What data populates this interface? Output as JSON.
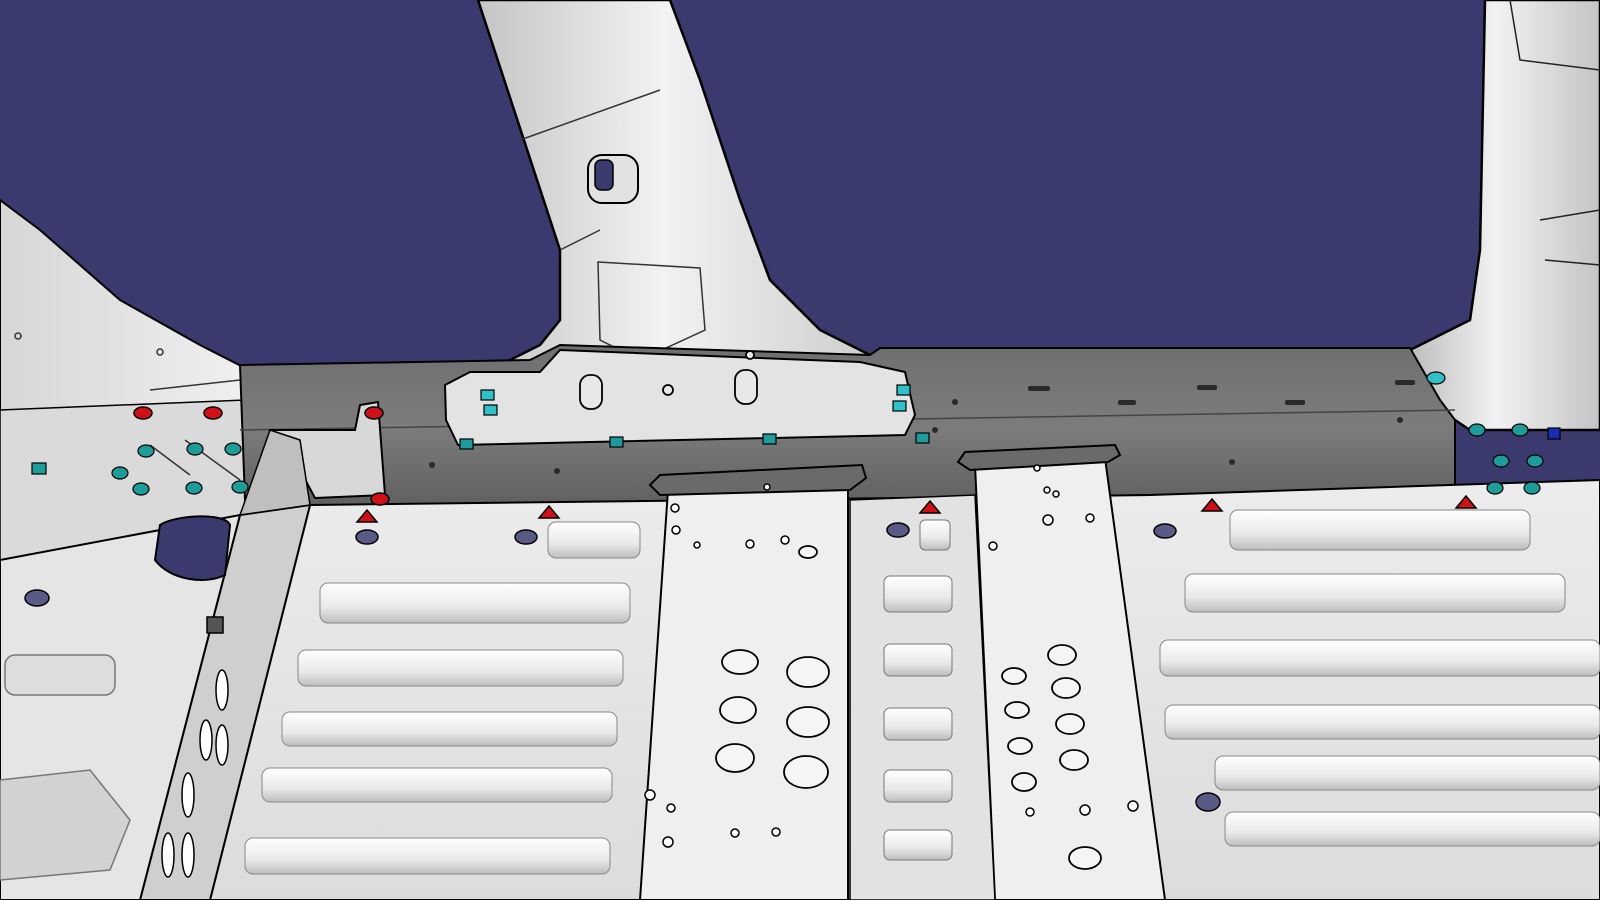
{
  "app": {
    "view_description_label": "",
    "background_color": "#3B3A6E"
  },
  "colors": {
    "sheet_metal_light": "#E6E6E6",
    "sheet_metal_mid": "#CFCFCF",
    "crossmember_dark": "#7A7A7A",
    "crossmember_darker": "#5F5F5F",
    "edge_line": "#000000",
    "hole_fill": "#5A5A86",
    "marker_red": "#D01018",
    "marker_cyan": "#2FC0C8",
    "marker_teal": "#1E9C9A",
    "marker_blue": "#1A2CB0"
  },
  "icons": {
    "weld_point_triangle": "red-triangle-icon",
    "weld_point_round": "red-dot-icon",
    "clip_square": "cyan-square-icon",
    "fastener_round": "teal-dot-icon",
    "datum_square": "blue-square-icon"
  }
}
